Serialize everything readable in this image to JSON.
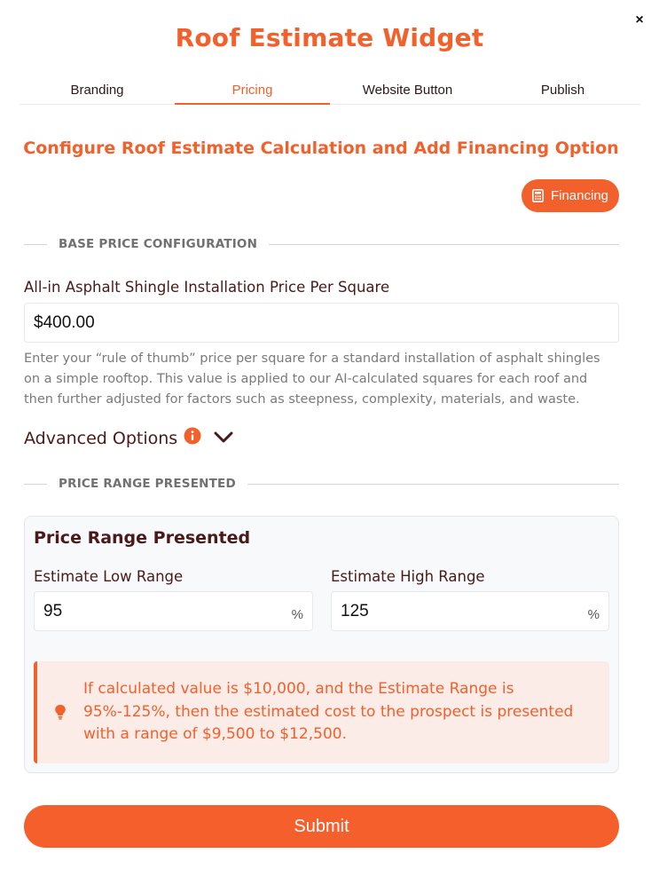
{
  "header": {
    "title": "Roof Estimate Widget",
    "close_label": "×"
  },
  "tabs": [
    {
      "label": "Branding",
      "active": false
    },
    {
      "label": "Pricing",
      "active": true
    },
    {
      "label": "Website Button",
      "active": false
    },
    {
      "label": "Publish",
      "active": false
    }
  ],
  "pricing": {
    "subtitle": "Configure Roof Estimate Calculation and Add Financing Option",
    "financing_button": {
      "label": "Financing",
      "icon": "calculator-icon"
    },
    "base_section": {
      "heading": "BASE PRICE CONFIGURATION",
      "field_label": "All-in Asphalt Shingle Installation Price Per Square",
      "field_value": "$400.00",
      "help_text": "Enter your “rule of thumb” price per square for a standard installation of asphalt shingles on a simple rooftop. This value is applied to our AI-calculated squares for each roof and then further adjusted for factors such as steepness, complexity, materials, and waste."
    },
    "advanced": {
      "label": "Advanced Options",
      "icon": "info-icon",
      "toggle_icon": "chevron-down-icon"
    },
    "range_section": {
      "heading": "PRICE RANGE PRESENTED",
      "card_title": "Price Range Presented",
      "low": {
        "label": "Estimate Low Range",
        "value": "95",
        "unit": "%"
      },
      "high": {
        "label": "Estimate High Range",
        "value": "125",
        "unit": "%"
      },
      "note": "If calculated value is $10,000, and the Estimate Range is 95%-125%, then the estimated cost to the prospect is presented with a range of $9,500 to $12,500.",
      "note_icon": "lightbulb-icon"
    },
    "submit_label": "Submit"
  },
  "colors": {
    "accent": "#f2602c",
    "text_dark": "#4a1a1a",
    "note_bg": "#fbece8"
  }
}
